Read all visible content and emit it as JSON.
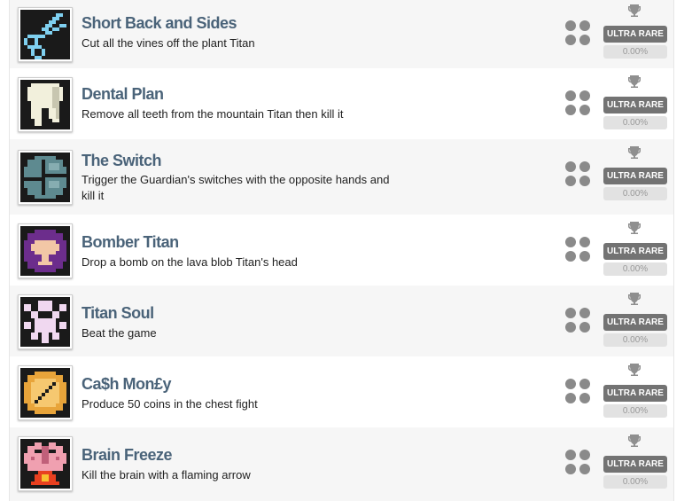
{
  "achievements": [
    {
      "title": "Short Back and Sides",
      "description": "Cut all the vines off the plant Titan",
      "icon": "scissors-icon",
      "rarity": "ULTRA RARE",
      "percent": "0.00%"
    },
    {
      "title": "Dental Plan",
      "description": "Remove all teeth from the mountain Titan then kill it",
      "icon": "tooth-icon",
      "rarity": "ULTRA RARE",
      "percent": "0.00%"
    },
    {
      "title": "The Switch",
      "description": "Trigger the Guardian's switches with the opposite hands and kill it",
      "icon": "guardian-switch-icon",
      "rarity": "ULTRA RARE",
      "percent": "0.00%"
    },
    {
      "title": "Bomber Titan",
      "description": "Drop a bomb on the lava blob Titan's head",
      "icon": "bomb-blast-icon",
      "rarity": "ULTRA RARE",
      "percent": "0.00%"
    },
    {
      "title": "Titan Soul",
      "description": "Beat the game",
      "icon": "titan-soul-icon",
      "rarity": "ULTRA RARE",
      "percent": "0.00%"
    },
    {
      "title": "Ca$h Mon£y",
      "description": "Produce 50 coins in the chest fight",
      "icon": "coin-icon",
      "rarity": "ULTRA RARE",
      "percent": "0.00%"
    },
    {
      "title": "Brain Freeze",
      "description": "Kill the brain with a flaming arrow",
      "icon": "flaming-brain-icon",
      "rarity": "ULTRA RARE",
      "percent": "0.00%"
    }
  ],
  "colors": {
    "title": "#4a6379",
    "badge": "#737373",
    "row_alt": "#f6f6f6"
  }
}
